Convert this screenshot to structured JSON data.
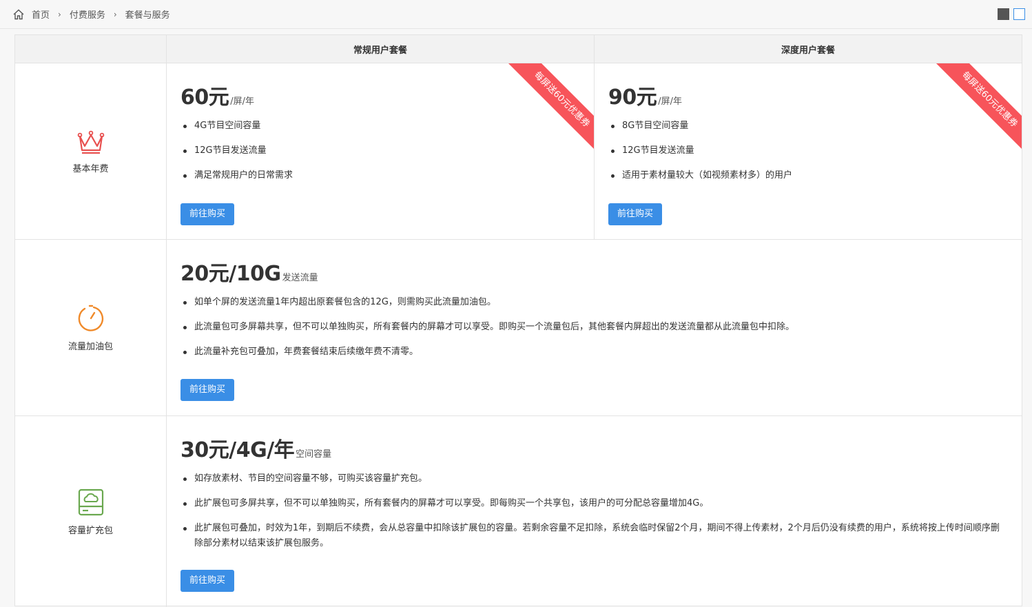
{
  "breadcrumb": {
    "home": "首页",
    "level2": "付费服务",
    "level3": "套餐与服务"
  },
  "table": {
    "headers": [
      "常规用户套餐",
      "深度用户套餐"
    ],
    "rows": {
      "annual": {
        "label": "基本年费",
        "icon": "crown-icon",
        "regular": {
          "price": "60元",
          "unit": "/屏/年",
          "ribbon": "每屏送60元优惠券",
          "features": [
            "4G节目空间容量",
            "12G节目发送流量",
            "满足常规用户的日常需求"
          ],
          "button": "前往购买"
        },
        "deep": {
          "price": "90元",
          "unit": "/屏/年",
          "ribbon": "每屏送60元优惠券",
          "features": [
            "8G节目空间容量",
            "12G节目发送流量",
            "适用于素材量较大（如视频素材多）的用户"
          ],
          "button": "前往购买"
        }
      },
      "traffic": {
        "label": "流量加油包",
        "icon": "timer-icon",
        "price": "20元/10G",
        "unit": "发送流量",
        "features": [
          "如单个屏的发送流量1年内超出原套餐包含的12G，则需购买此流量加油包。",
          "此流量包可多屏幕共享，但不可以单独购买，所有套餐内的屏幕才可以享受。即购买一个流量包后，其他套餐内屏超出的发送流量都从此流量包中扣除。",
          "此流量补充包可叠加，年费套餐结束后续缴年费不清零。"
        ],
        "button": "前往购买"
      },
      "storage": {
        "label": "容量扩充包",
        "icon": "cloud-disk-icon",
        "price": "30元/4G/年",
        "unit": "空间容量",
        "features": [
          "如存放素材、节目的空间容量不够，可购买该容量扩充包。",
          "此扩展包可多屏共享，但不可以单独购买，所有套餐内的屏幕才可以享受。即每购买一个共享包，该用户的可分配总容量增加4G。",
          "此扩展包可叠加，时效为1年，到期后不续费，会从总容量中扣除该扩展包的容量。若剩余容量不足扣除，系统会临时保留2个月，期间不得上传素材，2个月后仍没有续费的用户，系统将按上传时间顺序删除部分素材以结束该扩展包服务。"
        ],
        "button": "前往购买"
      }
    }
  },
  "colors": {
    "accent": "#3a8ee6",
    "ribbon": "#f7545a",
    "crown": "#e8504f",
    "timer": "#f08a2a",
    "disk": "#6aa84f"
  }
}
